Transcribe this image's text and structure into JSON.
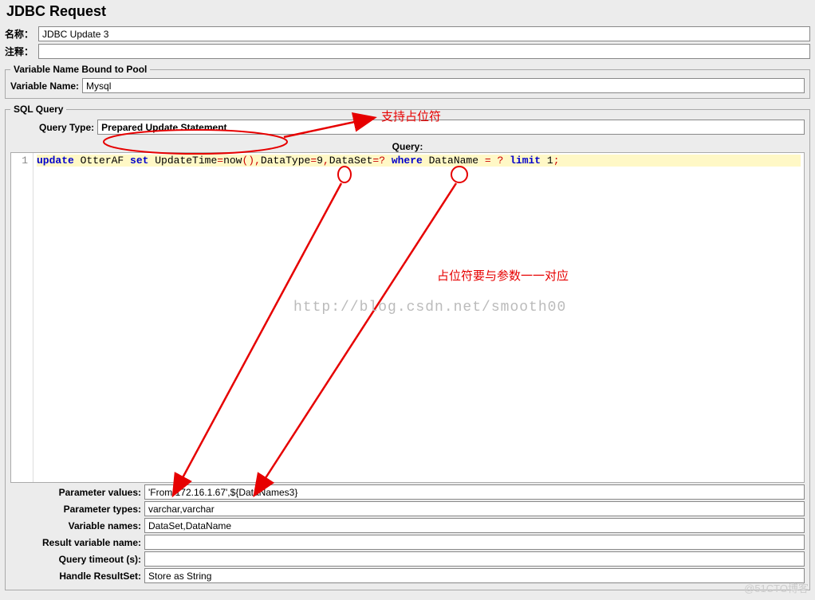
{
  "title": "JDBC Request",
  "name_label": "名称：",
  "name_value": "JDBC Update 3",
  "comment_label": "注释：",
  "comment_value": "",
  "pool_legend": "Variable Name Bound to Pool",
  "variable_name_label": "Variable Name:",
  "variable_name_value": "Mysql",
  "sql_legend": "SQL Query",
  "query_type_label": "Query Type:",
  "query_type_value": "Prepared Update Statement",
  "query_header": "Query:",
  "gutter_line": "1",
  "sql": {
    "kw1": "update",
    "tbl": " OtterAF ",
    "kw2": "set",
    "col1": " UpdateTime",
    "eq1": "=",
    "fn": "now",
    "paren": "()",
    "sep1": ",",
    "col2": "DataType",
    "eq2": "=",
    "val2": "9",
    "sep2": ",",
    "col3": "DataSet",
    "eq3": "=",
    "ph1": "?",
    "sp": " ",
    "kw3": "where",
    "col4": " DataName ",
    "eq4": "=",
    "sp2": " ",
    "ph2": "?",
    "sp3": " ",
    "kw4": "limit",
    "sp4": " ",
    "lim": "1",
    "semi": ";"
  },
  "anno1": "支持占位符",
  "anno2": "占位符要与参数一一对应",
  "watermark": "http://blog.csdn.net/smooth00",
  "params": {
    "values_label": "Parameter values:",
    "values": "'From:172.16.1.67',${DataNames3}",
    "types_label": "Parameter types:",
    "types": "varchar,varchar",
    "varnames_label": "Variable names:",
    "varnames": "DataSet,DataName",
    "resultvar_label": "Result variable name:",
    "resultvar": "",
    "timeout_label": "Query timeout (s):",
    "timeout": "",
    "handle_label": "Handle ResultSet:",
    "handle": "Store as String"
  },
  "copyright": "@51CTO博客"
}
